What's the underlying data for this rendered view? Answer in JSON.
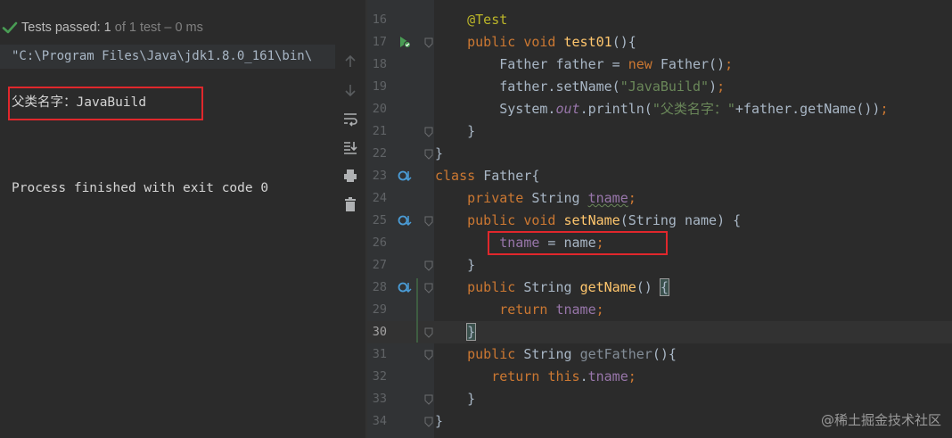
{
  "run": {
    "status_bold": "Tests passed: 1",
    "status_dim": "of 1 test – 0 ms",
    "command": "\"C:\\Program Files\\Java\\jdk1.8.0_161\\bin\\",
    "output_line": "父类名字：JavaBuild",
    "finished": "Process finished with exit code 0"
  },
  "toolbar": {
    "icons": [
      "up-arrow-icon",
      "down-arrow-icon",
      "soft-wrap-icon",
      "scroll-to-end-icon",
      "print-icon",
      "trash-icon"
    ]
  },
  "editor": {
    "line_numbers": [
      "16",
      "17",
      "18",
      "19",
      "20",
      "21",
      "22",
      "23",
      "24",
      "25",
      "26",
      "27",
      "28",
      "29",
      "30",
      "31",
      "32",
      "33",
      "34"
    ],
    "lines": [
      [
        {
          "t": "    "
        },
        {
          "t": "@Test",
          "c": "ann"
        }
      ],
      [
        {
          "t": "    "
        },
        {
          "t": "public void ",
          "c": "kw"
        },
        {
          "t": "test01",
          "c": "fn"
        },
        {
          "t": "(){"
        }
      ],
      [
        {
          "t": "        Father father = "
        },
        {
          "t": "new ",
          "c": "kw"
        },
        {
          "t": "Father()"
        },
        {
          "t": ";",
          "c": "kw"
        }
      ],
      [
        {
          "t": "        father.setName("
        },
        {
          "t": "\"JavaBuild\"",
          "c": "str"
        },
        {
          "t": ")"
        },
        {
          "t": ";",
          "c": "kw"
        }
      ],
      [
        {
          "t": "        System."
        },
        {
          "t": "out",
          "c": "it"
        },
        {
          "t": ".println("
        },
        {
          "t": "\"父类名字：\"",
          "c": "str"
        },
        {
          "t": "+father.getName())"
        },
        {
          "t": ";",
          "c": "kw"
        }
      ],
      [
        {
          "t": "    }"
        }
      ],
      [
        {
          "t": "}"
        }
      ],
      [
        {
          "t": "class ",
          "c": "kw"
        },
        {
          "t": "Father{"
        }
      ],
      [
        {
          "t": "    "
        },
        {
          "t": "private ",
          "c": "kw"
        },
        {
          "t": "String "
        },
        {
          "t": "tname",
          "c": "fldw"
        },
        {
          "t": ";",
          "c": "kw"
        }
      ],
      [
        {
          "t": "    "
        },
        {
          "t": "public void ",
          "c": "kw"
        },
        {
          "t": "setName",
          "c": "fn"
        },
        {
          "t": "(String name) {"
        }
      ],
      [
        {
          "t": "        "
        },
        {
          "t": "tname",
          "c": "fld"
        },
        {
          "t": " = name"
        },
        {
          "t": ";",
          "c": "kw"
        }
      ],
      [
        {
          "t": "    }"
        }
      ],
      [
        {
          "t": "    "
        },
        {
          "t": "public ",
          "c": "kw"
        },
        {
          "t": "String "
        },
        {
          "t": "getName",
          "c": "fn"
        },
        {
          "t": "() "
        },
        {
          "t": "{",
          "c": "brace"
        }
      ],
      [
        {
          "t": "        "
        },
        {
          "t": "return ",
          "c": "kw"
        },
        {
          "t": "tname",
          "c": "fld"
        },
        {
          "t": ";",
          "c": "kw"
        }
      ],
      [
        {
          "t": "    "
        },
        {
          "t": "}",
          "c": "brace"
        }
      ],
      [
        {
          "t": "    "
        },
        {
          "t": "public ",
          "c": "kw"
        },
        {
          "t": "String "
        },
        {
          "t": "getFather",
          "c": "dim"
        },
        {
          "t": "(){"
        }
      ],
      [
        {
          "t": "       "
        },
        {
          "t": "return ",
          "c": "kw"
        },
        {
          "t": "this",
          "c": "kw"
        },
        {
          "t": "."
        },
        {
          "t": "tname",
          "c": "fld"
        },
        {
          "t": ";",
          "c": "kw"
        }
      ],
      [
        {
          "t": "    }"
        }
      ],
      [
        {
          "t": "}"
        }
      ]
    ],
    "current_line": "30"
  },
  "watermark": "@稀土掘金技术社区",
  "colors": {
    "background": "#2b2b2b",
    "keyword": "#cc7832",
    "function": "#ffc66d",
    "string": "#6a8759",
    "field": "#9876aa",
    "annotation": "#bbb529",
    "highlight_box": "#e0272c",
    "test_pass": "#499c54"
  }
}
